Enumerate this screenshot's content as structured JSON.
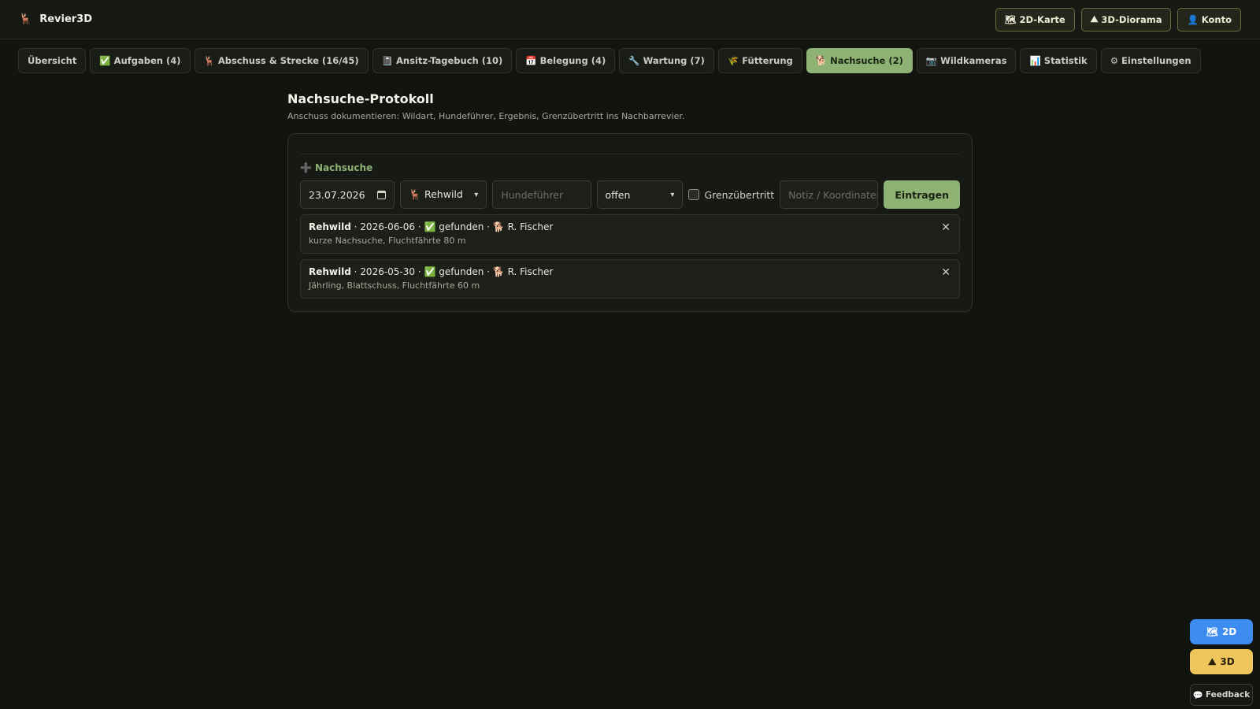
{
  "app": {
    "logo_icon": "🦌",
    "name": "Revier3D"
  },
  "top_actions": [
    {
      "icon": "🗺",
      "label": "2D-Karte"
    },
    {
      "icon": "⛰",
      "label": "3D-Diorama"
    },
    {
      "icon": "👤",
      "label": "Konto"
    }
  ],
  "tabs": [
    {
      "icon": "",
      "label": "Übersicht"
    },
    {
      "icon": "✅",
      "label": "Aufgaben (4)"
    },
    {
      "icon": "🦌",
      "label": "Abschuss & Strecke (16/45)"
    },
    {
      "icon": "📓",
      "label": "Ansitz-Tagebuch (10)"
    },
    {
      "icon": "📅",
      "label": "Belegung (4)"
    },
    {
      "icon": "🔧",
      "label": "Wartung (7)"
    },
    {
      "icon": "🌾",
      "label": "Fütterung"
    },
    {
      "icon": "🐕",
      "label": "Nachsuche (2)",
      "active": true
    },
    {
      "icon": "📷",
      "label": "Wildkameras"
    },
    {
      "icon": "📊",
      "label": "Statistik"
    },
    {
      "icon": "⚙",
      "label": "Einstellungen"
    }
  ],
  "page": {
    "title": "Nachsuche-Protokoll",
    "subtitle": "Anschuss dokumentieren: Wildart, Hundeführer, Ergebnis, Grenzübertritt ins Nachbarrevier."
  },
  "form": {
    "section_icon": "➕",
    "section_label": "Nachsuche",
    "date_value": "23.07.2026",
    "wildart_icon": "🦌",
    "wildart_value": "Rehwild",
    "hundefuehrer_placeholder": "Hundeführer",
    "status_value": "offen",
    "grenz_label": "Grenzübertritt",
    "notiz_placeholder": "Notiz / Koordinaten",
    "submit_label": "Eintragen"
  },
  "entries": [
    {
      "wildart": "Rehwild",
      "date": "2026-06-06",
      "result_icon": "✅",
      "result": "gefunden",
      "dog_icon": "🐕",
      "handler": "R. Fischer",
      "note": "kurze Nachsuche, Fluchtfährte 80 m"
    },
    {
      "wildart": "Rehwild",
      "date": "2026-05-30",
      "result_icon": "✅",
      "result": "gefunden",
      "dog_icon": "🐕",
      "handler": "R. Fischer",
      "note": "Jährling, Blattschuss, Fluchtfährte 60 m"
    }
  ],
  "floating": {
    "btn_2d_icon": "🗺",
    "btn_2d_label": "2D",
    "btn_3d_icon": "⛰",
    "btn_3d_label": "3D",
    "feedback_icon": "💬",
    "feedback_label": "Feedback"
  },
  "colors": {
    "accent": "#8db274",
    "background": "#121410",
    "btn_2d": "#3d8cf2",
    "btn_3d": "#efc65c"
  }
}
